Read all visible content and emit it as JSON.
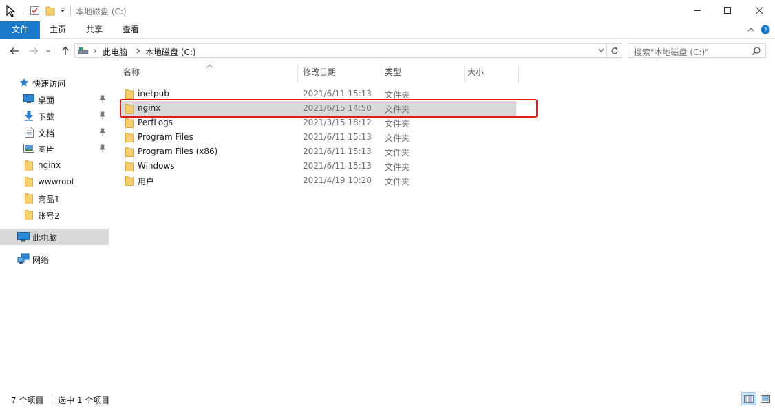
{
  "window": {
    "title": "本地磁盘 (C:)",
    "minimize_glyph": "—",
    "maximize_glyph": "☐",
    "close_glyph": "✕"
  },
  "ribbon": {
    "tabs": [
      {
        "label": "文件"
      },
      {
        "label": "主页"
      },
      {
        "label": "共享"
      },
      {
        "label": "查看"
      }
    ]
  },
  "address": {
    "breadcrumb": [
      "此电脑",
      "本地磁盘 (C:)"
    ],
    "search_placeholder": "搜索\"本地磁盘 (C:)\""
  },
  "nav": {
    "quick_access": "快速访问",
    "items": [
      {
        "label": "桌面",
        "icon": "desktop-icon",
        "pinned": true
      },
      {
        "label": "下载",
        "icon": "download-icon",
        "pinned": true
      },
      {
        "label": "文档",
        "icon": "document-icon",
        "pinned": true
      },
      {
        "label": "图片",
        "icon": "picture-icon",
        "pinned": true
      },
      {
        "label": "nginx",
        "icon": "folder-icon",
        "pinned": false
      },
      {
        "label": "wwwroot",
        "icon": "folder-icon",
        "pinned": false
      },
      {
        "label": "商品1",
        "icon": "folder-icon",
        "pinned": false
      },
      {
        "label": "账号2",
        "icon": "folder-icon",
        "pinned": false
      }
    ],
    "this_pc": "此电脑",
    "network": "网络"
  },
  "columns": {
    "name": "名称",
    "date": "修改日期",
    "type": "类型",
    "size": "大小"
  },
  "files": [
    {
      "name": "inetpub",
      "date": "2021/6/11 15:13",
      "type": "文件夹"
    },
    {
      "name": "nginx",
      "date": "2021/6/15 14:50",
      "type": "文件夹"
    },
    {
      "name": "PerfLogs",
      "date": "2021/3/15 18:12",
      "type": "文件夹"
    },
    {
      "name": "Program Files",
      "date": "2021/6/11 15:13",
      "type": "文件夹"
    },
    {
      "name": "Program Files (x86)",
      "date": "2021/6/11 15:13",
      "type": "文件夹"
    },
    {
      "name": "Windows",
      "date": "2021/6/11 15:13",
      "type": "文件夹"
    },
    {
      "name": "用户",
      "date": "2021/4/19 10:20",
      "type": "文件夹"
    }
  ],
  "selected_file": "nginx",
  "status": {
    "count": "7 个项目",
    "selected": "选中 1 个项目"
  },
  "colors": {
    "accent": "#1979ca",
    "selection": "#d9d9d9",
    "highlight_border": "#e11c1c",
    "folder": "#f5cf6c"
  }
}
